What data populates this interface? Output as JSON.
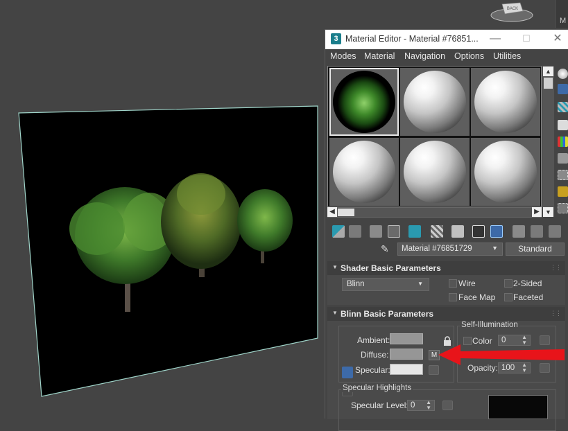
{
  "viewport": {
    "viewcube_label": "BACK",
    "edge_label": "M"
  },
  "window": {
    "app_icon_text": "3",
    "title": "Material Editor - Material #76851...",
    "minimize_glyph": "—",
    "maximize_glyph": "☐",
    "close_glyph": "✕"
  },
  "menu": [
    "Modes",
    "Material",
    "Navigation",
    "Options",
    "Utilities"
  ],
  "material": {
    "name": "Material #76851729",
    "type_button": "Standard"
  },
  "shader_rollout": {
    "title": "Shader Basic Parameters",
    "shader": "Blinn",
    "wire": "Wire",
    "two_sided": "2-Sided",
    "face_map": "Face Map",
    "faceted": "Faceted"
  },
  "blinn_rollout": {
    "title": "Blinn Basic Parameters",
    "ambient": "Ambient:",
    "diffuse": "Diffuse:",
    "specular": "Specular:",
    "diffuse_map_button": "M",
    "self_illum_title": "Self-Illumination",
    "color_label": "Color",
    "color_value": "0",
    "opacity_label": "Opacity:",
    "opacity_value": "100",
    "spec_highlights_title": "Specular Highlights",
    "spec_level_label": "Specular Level:",
    "spec_level_value": "0"
  },
  "colors": {
    "ambient_swatch": "#969696",
    "diffuse_swatch": "#969696",
    "specular_swatch": "#e6e6e6",
    "annotation_arrow": "#e8141a",
    "plane_outline": "#9fd4c9"
  }
}
